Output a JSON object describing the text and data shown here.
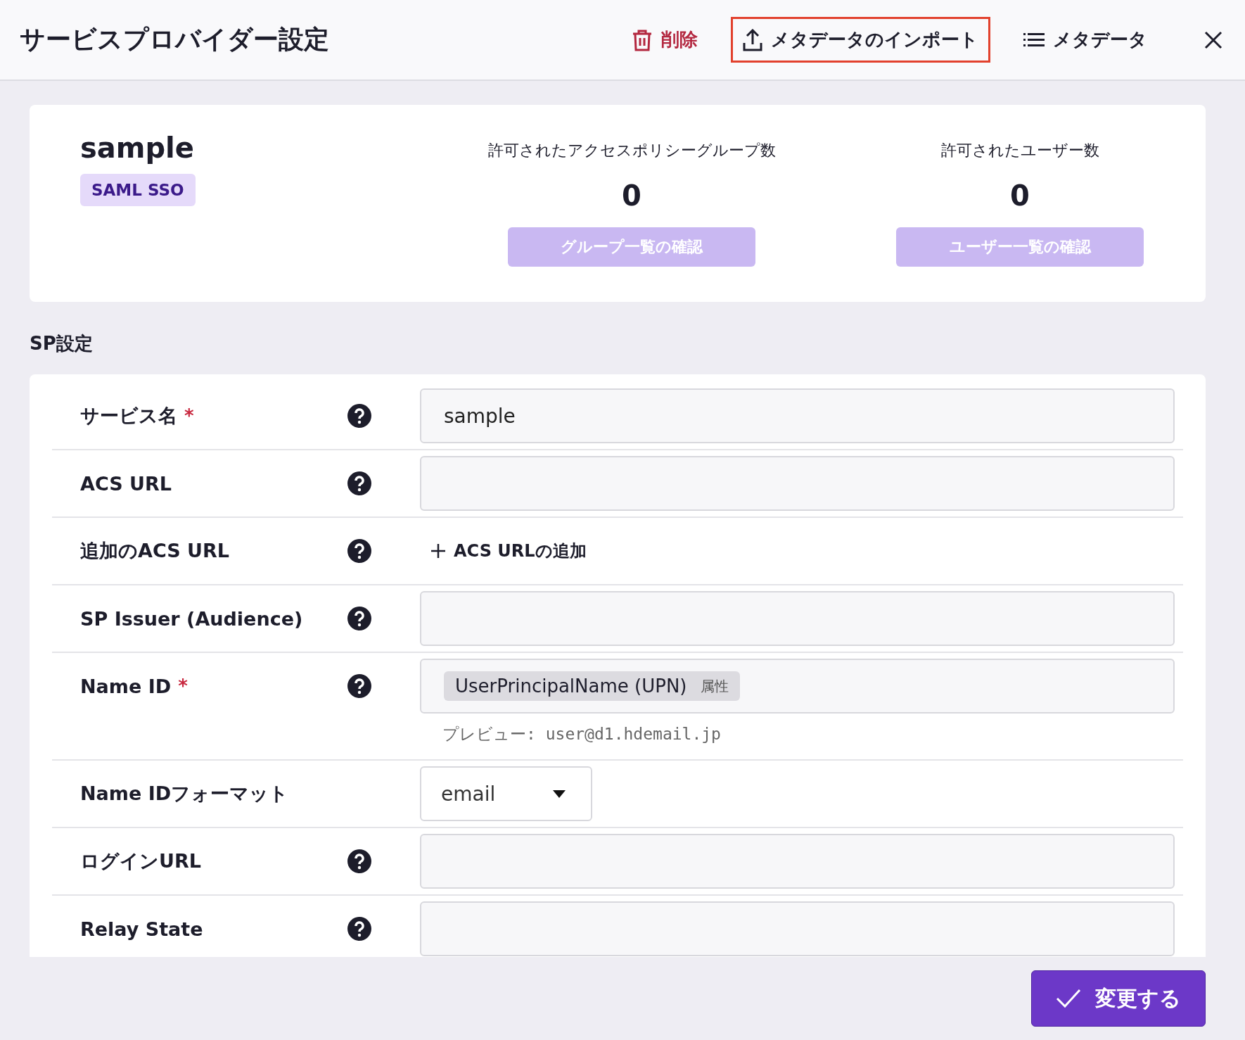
{
  "window": {
    "title": "サービスプロバイダー設定"
  },
  "toolbar": [
    {
      "kind": "delete",
      "label": "削除",
      "highlighted": false
    },
    {
      "kind": "import",
      "label": "メタデータのインポート",
      "highlighted": true
    },
    {
      "kind": "metadata",
      "label": "メタデータ",
      "highlighted": false
    }
  ],
  "summary": {
    "name": "sample",
    "badge": "SAML SSO",
    "stats": [
      {
        "label": "許可されたアクセスポリシーグループ数",
        "value": "0",
        "button": "グループ一覧の確認"
      },
      {
        "label": "許可されたユーザー数",
        "value": "0",
        "button": "ユーザー一覧の確認"
      }
    ]
  },
  "section_title": "SP設定",
  "rows": [
    {
      "label": "サービス名",
      "required": true,
      "help": true,
      "kind": "input",
      "value": "sample"
    },
    {
      "label": "ACS URL",
      "required": false,
      "help": true,
      "kind": "input"
    },
    {
      "label": "追加のACS URL",
      "required": false,
      "help": true,
      "kind": "add",
      "action": "ACS URLの追加"
    },
    {
      "label": "SP Issuer (Audience)",
      "required": false,
      "help": true,
      "kind": "input"
    },
    {
      "label": "Name ID",
      "required": true,
      "help": true,
      "kind": "tag",
      "tag": "UserPrincipalName (UPN)",
      "tag_suffix": "属性",
      "preview_label": "プレビュー:",
      "preview": "user@d1.hdemail.jp"
    },
    {
      "label": "Name IDフォーマット",
      "required": false,
      "help": false,
      "kind": "select",
      "value": "email"
    },
    {
      "label": "ログインURL",
      "required": false,
      "help": true,
      "kind": "input"
    },
    {
      "label": "Relay State",
      "required": false,
      "help": true,
      "kind": "input"
    }
  ],
  "required_mark": "*",
  "submit": "変更する"
}
